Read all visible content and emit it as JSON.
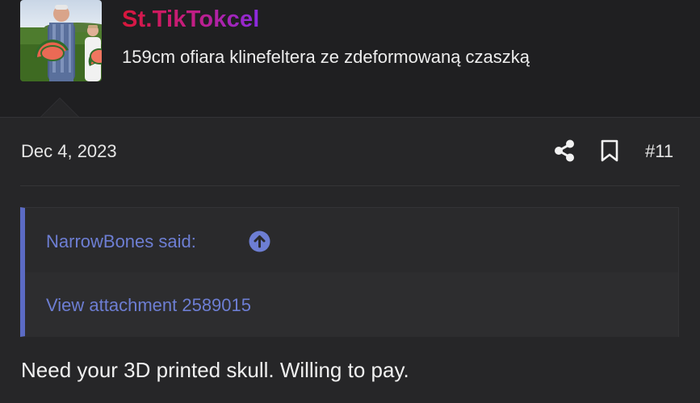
{
  "user": {
    "avatar": "avatar",
    "username": "St.TikTokcel",
    "title": "159cm ofiara klinefeltera ze zdeformowaną czaszką",
    "username_gradient": [
      "#d9173a",
      "#c01e8a",
      "#8a2be2"
    ]
  },
  "post": {
    "date": "Dec 4, 2023",
    "number": "#11",
    "actions": {
      "share_icon": "share-icon",
      "bookmark_icon": "bookmark-icon"
    },
    "quote": {
      "author_label": "NarrowBones said:",
      "jump_icon": "arrow-up-circle-icon",
      "attachment_text": "View attachment 2589015",
      "accent_color": "#5b6bc4",
      "link_color": "#6d7ed3"
    },
    "message": "Need your 3D printed skull. Willing to pay."
  }
}
